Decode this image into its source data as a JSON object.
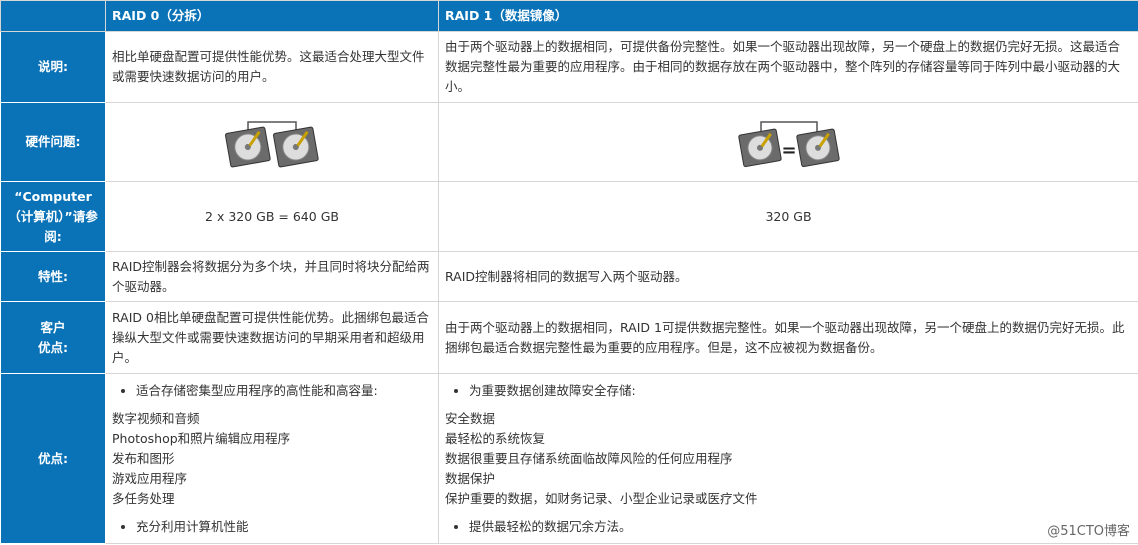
{
  "header": {
    "col1": "",
    "col2": "RAID 0（分拆）",
    "col3": "RAID 1（数据镜像）"
  },
  "rows": [
    {
      "label": "说明:",
      "raid0": "相比单硬盘配置可提供性能优势。这最适合处理大型文件或需要快速数据访问的用户。",
      "raid1": "由于两个驱动器上的数据相同，可提供备份完整性。如果一个驱动器出现故障，另一个硬盘上的数据仍完好无损。这最适合数据完整性最为重要的应用程序。由于相同的数据存放在两个驱动器中，整个阵列的存储容量等同于阵列中最小驱动器的大小。"
    },
    {
      "label": "硬件问题:",
      "raid0_icon": "hard-drive-pair-icon",
      "raid1_icon": "mirrored-hard-drive-icon",
      "equals": "="
    },
    {
      "label": "“Computer（计算机）”请参阅:",
      "raid0": "2 x 320 GB = 640 GB",
      "raid1": "320 GB"
    },
    {
      "label": "特性:",
      "raid0": "RAID控制器会将数据分为多个块，并且同时将块分配给两个驱动器。",
      "raid1": "RAID控制器将相同的数据写入两个驱动器。"
    },
    {
      "label_line1": "客户",
      "label_line2": "优点:",
      "raid0": "RAID 0相比单硬盘配置可提供性能优势。此捆绑包最适合操纵大型文件或需要快速数据访问的早期采用者和超级用户。",
      "raid1": "由于两个驱动器上的数据相同，RAID 1可提供数据完整性。如果一个驱动器出现故障，另一个硬盘上的数据仍完好无损。此捆绑包最适合数据完整性最为重要的应用程序。但是，这不应被视为数据备份。"
    },
    {
      "label": "优点:",
      "raid0": {
        "intro": "适合存储密集型应用程序的高性能和高容量:",
        "items": [
          "数字视频和音频",
          "Photoshop和照片编辑应用程序",
          "发布和图形",
          "游戏应用程序",
          "多任务处理"
        ],
        "last": "充分利用计算机性能"
      },
      "raid1": {
        "intro": "为重要数据创建故障安全存储:",
        "items": [
          "安全数据",
          "最轻松的系统恢复",
          "数据很重要且存储系统面临故障风险的任何应用程序",
          "数据保护",
          "保护重要的数据，如财务记录、小型企业记录或医疗文件"
        ],
        "last": "提供最轻松的数据冗余方法。"
      }
    }
  ],
  "watermark": "@51CTO博客"
}
